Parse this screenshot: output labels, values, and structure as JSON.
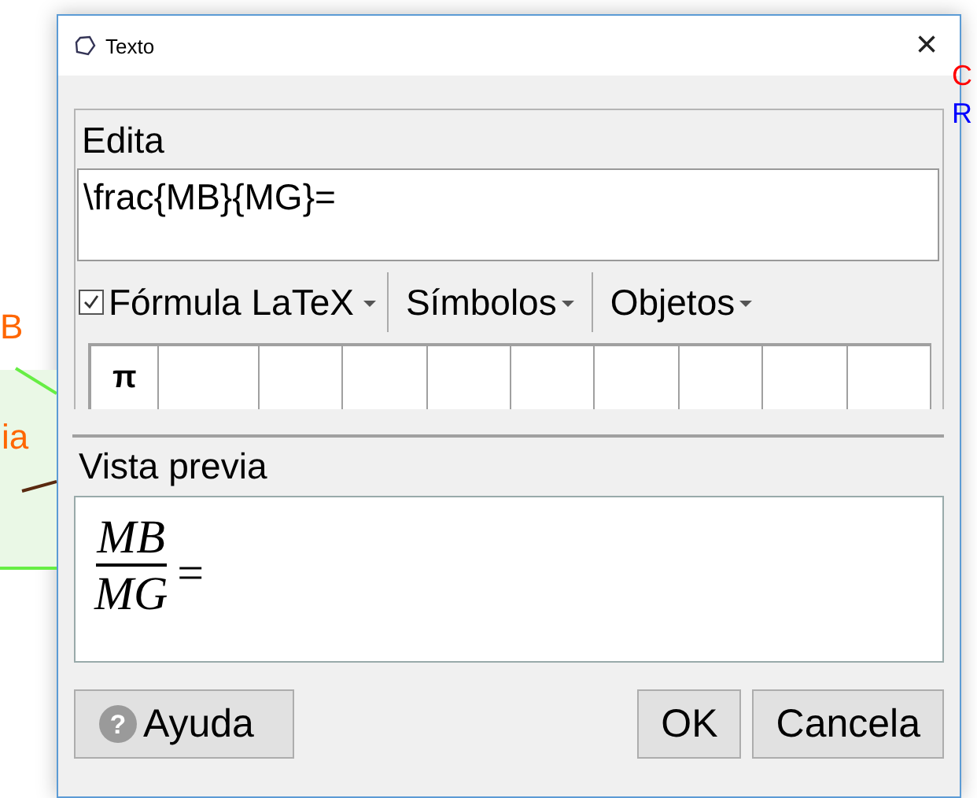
{
  "background": {
    "left_labels": [
      "B",
      "ia"
    ],
    "right_labels": [
      {
        "text": "C",
        "color": "#ff0000"
      },
      {
        "text": "R",
        "color": "#0000ff"
      }
    ]
  },
  "window": {
    "title": "Texto",
    "close": "×"
  },
  "edit": {
    "label": "Edita",
    "value": "\\frac{MB}{MG}="
  },
  "toolbar": [
    {
      "kind": "checkbox",
      "label": "Fórmula LaTeX",
      "checked": true
    },
    {
      "kind": "menu",
      "label": "Símbolos"
    },
    {
      "kind": "menu",
      "label": "Objetos"
    }
  ],
  "symbols": [
    "π"
  ],
  "preview": {
    "label": "Vista previa",
    "numerator": "MB",
    "denominator": "MG",
    "relation": "="
  },
  "buttons": [
    {
      "kind": "help",
      "label": "Ayuda",
      "icon": "?"
    },
    {
      "kind": "plain",
      "label": "OK"
    },
    {
      "kind": "plain",
      "label": "Cancela"
    }
  ]
}
